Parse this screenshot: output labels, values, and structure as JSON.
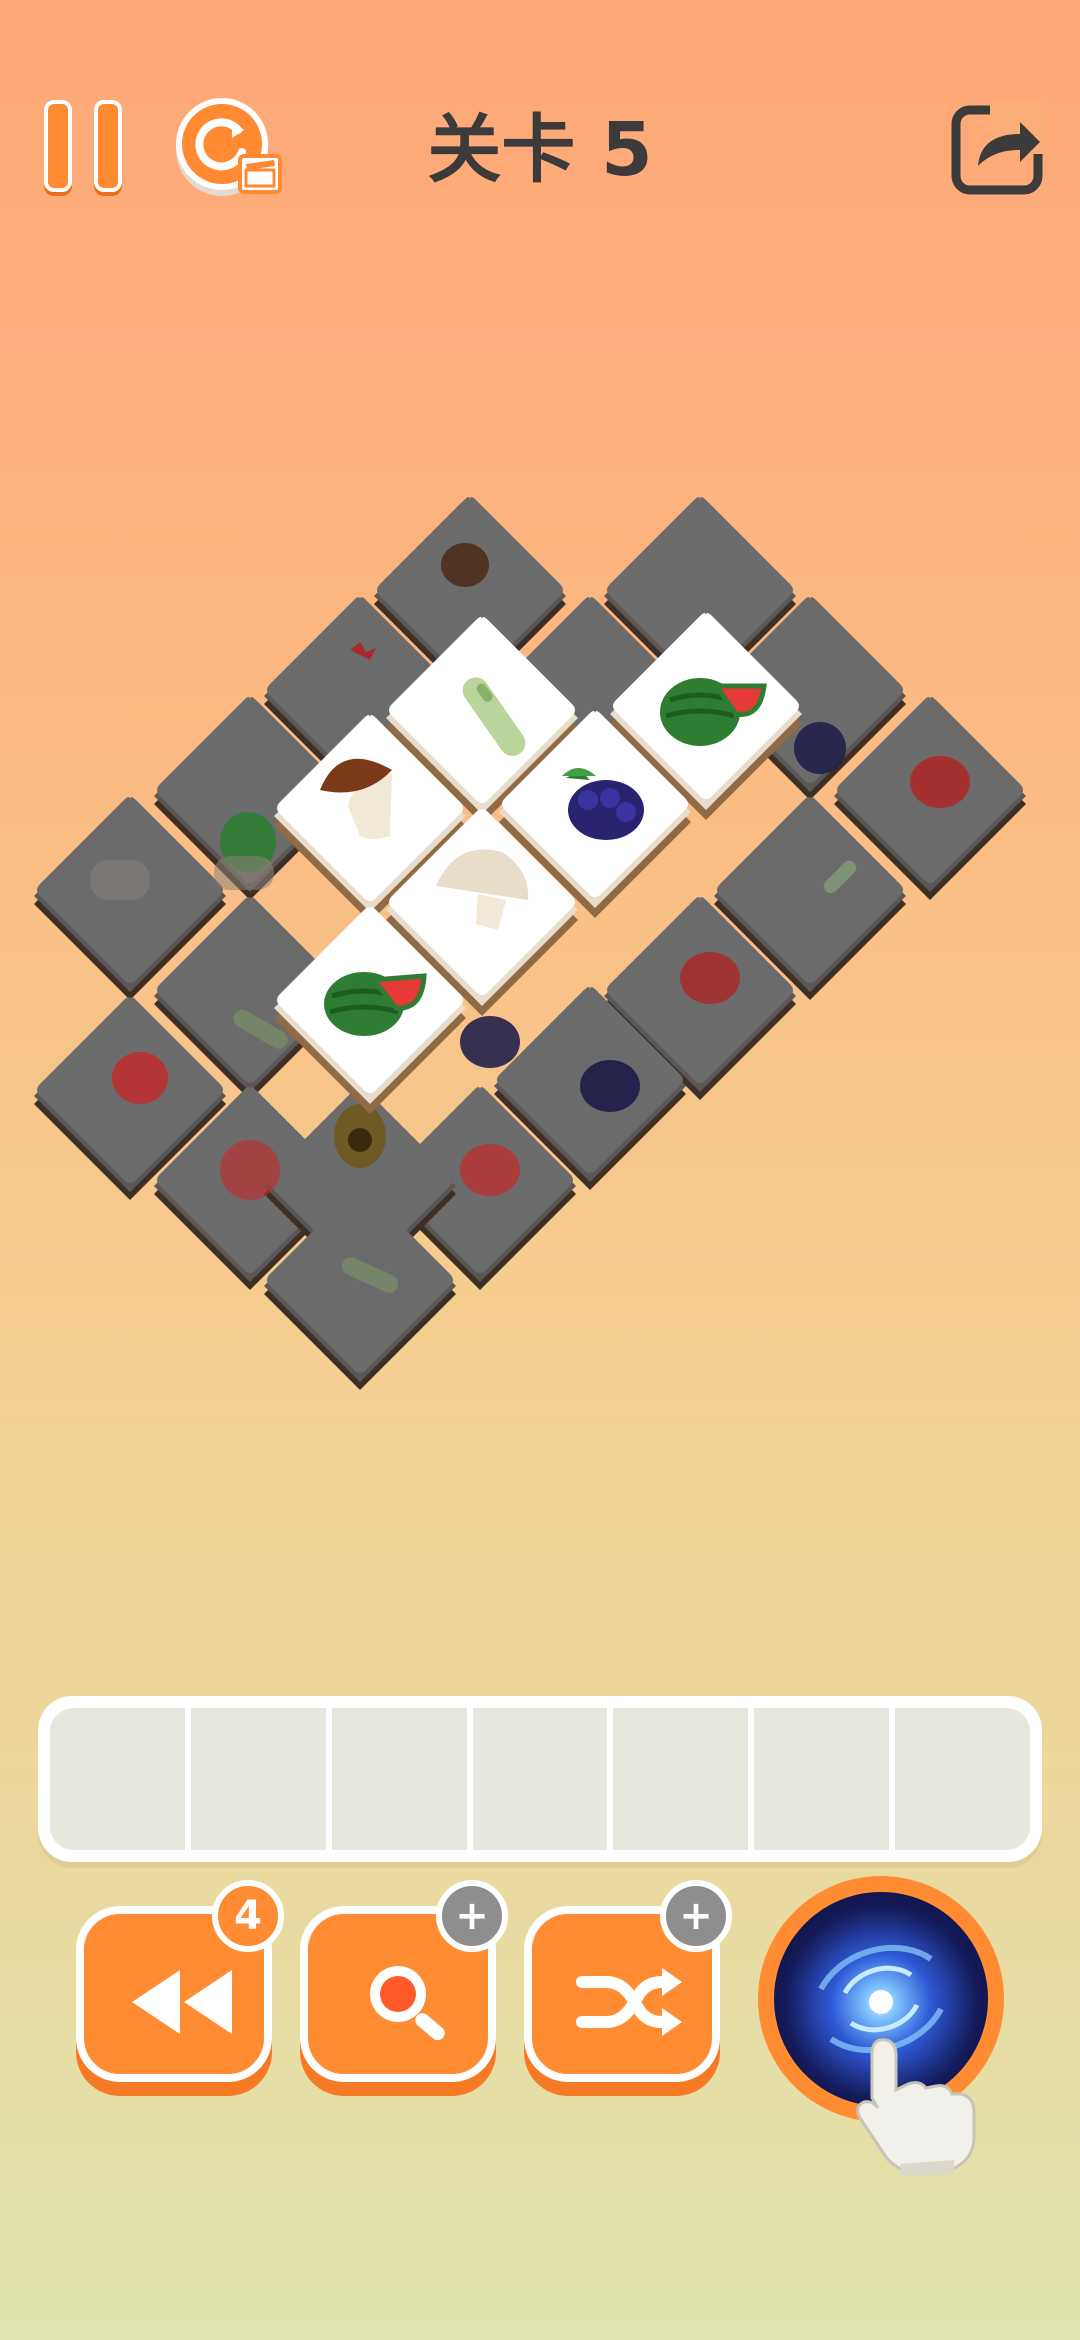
{
  "header": {
    "title": "关卡 5",
    "pause_icon": "pause-icon",
    "restart_icon": "restart-video-icon",
    "share_icon": "share-icon"
  },
  "board": {
    "top_tiles": [
      "zucchini",
      "watermelon",
      "porcini-mushroom",
      "blackberry",
      "champignon-mushroom",
      "watermelon"
    ],
    "lower_tiles": [
      "avocado",
      "eggplant",
      "maple-leaf",
      "kiwi",
      "watermelon",
      "blackberry",
      "mushroom",
      "zucchini",
      "tomato",
      "strawberry",
      "zucchini",
      "blackberry",
      "blackberry",
      "tomato",
      "pomegranate",
      "avocado",
      "tomato",
      "zucchini"
    ]
  },
  "tray": {
    "slots": 7
  },
  "tools": {
    "undo": {
      "count": "4",
      "icon": "rewind-icon"
    },
    "hint": {
      "badge": "+",
      "icon": "magnifier-icon"
    },
    "shuffle": {
      "badge": "+",
      "icon": "shuffle-icon"
    },
    "blackhole": {
      "icon": "blackhole-icon"
    }
  },
  "colors": {
    "accent": "#ff8c33",
    "tile_top": "#ffffff",
    "tile_dark": "#636363",
    "title": "#3c3a3a"
  }
}
